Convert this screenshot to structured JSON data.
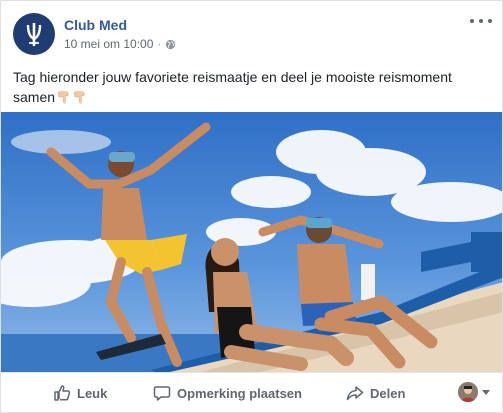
{
  "post": {
    "page_name": "Club Med",
    "date": "10 mei om 10:00",
    "separator": "·",
    "text": "Tag hieronder jouw favoriete reismaatje en deel je mooiste reismoment samen"
  },
  "actions": {
    "like": "Leuk",
    "comment": "Opmerking plaatsen",
    "share": "Delen"
  },
  "icons": {
    "logo": "club-med-trident-icon",
    "privacy": "globe-icon",
    "more": "more-options-icon",
    "like": "thumbs-up-icon",
    "comment": "comment-icon",
    "share": "share-arrow-icon",
    "emoji": "pointing-down-hand-icon"
  },
  "colors": {
    "link": "#365899",
    "logo_bg": "#1f3c73",
    "action_text": "#606770",
    "sky": "#3f7fd0",
    "boat": "#1e5ea8"
  }
}
